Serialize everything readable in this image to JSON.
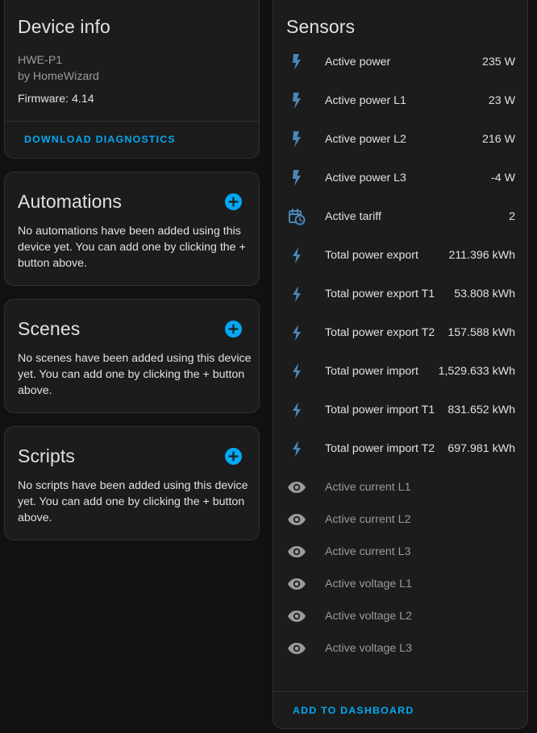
{
  "device_info": {
    "title": "Device info",
    "model": "HWE-P1",
    "manufacturer": "by HomeWizard",
    "firmware": "Firmware: 4.14",
    "download_label": "DOWNLOAD DIAGNOSTICS"
  },
  "automations": {
    "title": "Automations",
    "empty_text": "No automations have been added using this device yet. You can add one by clicking the + button above."
  },
  "scenes": {
    "title": "Scenes",
    "empty_text": "No scenes have been added using this device yet. You can add one by clicking the + button above."
  },
  "scripts": {
    "title": "Scripts",
    "empty_text": "No scripts have been added using this device yet. You can add one by clicking the + button above."
  },
  "sensors": {
    "title": "Sensors",
    "add_to_dashboard_label": "ADD TO DASHBOARD",
    "items": [
      {
        "name": "Active power",
        "value": "235 W",
        "icon": "flash-icon"
      },
      {
        "name": "Active power L1",
        "value": "23 W",
        "icon": "flash-icon"
      },
      {
        "name": "Active power L2",
        "value": "216 W",
        "icon": "flash-icon"
      },
      {
        "name": "Active power L3",
        "value": "-4 W",
        "icon": "flash-icon"
      },
      {
        "name": "Active tariff",
        "value": "2",
        "icon": "calendar-clock-icon"
      },
      {
        "name": "Total power export",
        "value": "211.396 kWh",
        "icon": "lightning-bolt-icon"
      },
      {
        "name": "Total power export T1",
        "value": "53.808 kWh",
        "icon": "lightning-bolt-icon"
      },
      {
        "name": "Total power export T2",
        "value": "157.588 kWh",
        "icon": "lightning-bolt-icon"
      },
      {
        "name": "Total power import",
        "value": "1,529.633 kWh",
        "icon": "lightning-bolt-icon"
      },
      {
        "name": "Total power import T1",
        "value": "831.652 kWh",
        "icon": "lightning-bolt-icon"
      },
      {
        "name": "Total power import T2",
        "value": "697.981 kWh",
        "icon": "lightning-bolt-icon"
      }
    ],
    "hidden_items": [
      {
        "name": "Active current L1",
        "icon": "eye-icon"
      },
      {
        "name": "Active current L2",
        "icon": "eye-icon"
      },
      {
        "name": "Active current L3",
        "icon": "eye-icon"
      },
      {
        "name": "Active voltage L1",
        "icon": "eye-icon"
      },
      {
        "name": "Active voltage L2",
        "icon": "eye-icon"
      },
      {
        "name": "Active voltage L3",
        "icon": "eye-icon"
      }
    ]
  },
  "colors": {
    "accent": "#03a9f4",
    "icon": "#4a87b8",
    "muted_icon": "#9b9b9b",
    "card_bg": "#1c1c1c",
    "page_bg": "#111111"
  }
}
